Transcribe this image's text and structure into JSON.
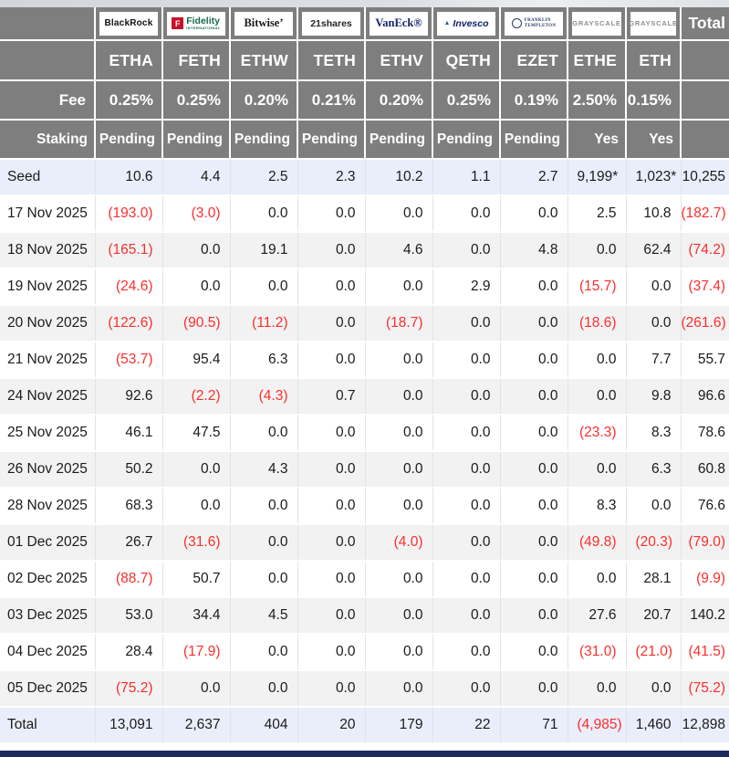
{
  "page": {
    "fee_label": "Fee",
    "staking_label": "Staking",
    "total_label": "Total",
    "colors": {
      "header_bg": "#7e7e7e",
      "negative_text": "#fb2d2d",
      "highlight_row_bg": "#e9eefa",
      "alt_row_bg": "#f2f2f2",
      "bottom_bar": "#1d2a5c"
    }
  },
  "chart_data": {
    "type": "table",
    "total_column_label": "Total",
    "row_header_labels": {
      "fee": "Fee",
      "staking": "Staking"
    },
    "columns": [
      {
        "issuer": "BlackRock",
        "ticker": "ETHA",
        "fee": "0.25%",
        "staking": "Pending",
        "logo": {
          "type": "blackrock",
          "text": "BlackRock"
        }
      },
      {
        "issuer": "Fidelity",
        "ticker": "FETH",
        "fee": "0.25%",
        "staking": "Pending",
        "logo": {
          "type": "fidelity",
          "icon": "F",
          "text": "Fidelity",
          "subtext": "INTERNATIONAL"
        }
      },
      {
        "issuer": "Bitwise",
        "ticker": "ETHW",
        "fee": "0.20%",
        "staking": "Pending",
        "logo": {
          "type": "bitwise",
          "text": "Bitwise’"
        }
      },
      {
        "issuer": "21shares",
        "ticker": "TETH",
        "fee": "0.21%",
        "staking": "Pending",
        "logo": {
          "type": "shares21",
          "text": "21shares"
        }
      },
      {
        "issuer": "VanEck",
        "ticker": "ETHV",
        "fee": "0.20%",
        "staking": "Pending",
        "logo": {
          "type": "vaneck",
          "text": "VanEck®"
        }
      },
      {
        "issuer": "Invesco",
        "ticker": "QETH",
        "fee": "0.25%",
        "staking": "Pending",
        "logo": {
          "type": "invesco",
          "icon": "▲",
          "text": "Invesco"
        }
      },
      {
        "issuer": "Franklin Templeton",
        "ticker": "EZET",
        "fee": "0.19%",
        "staking": "Pending",
        "logo": {
          "type": "franklin",
          "line1": "FRANKLIN",
          "line2": "TEMPLETON"
        }
      },
      {
        "issuer": "Grayscale",
        "ticker": "ETHE",
        "fee": "2.50%",
        "staking": "Yes",
        "logo": {
          "type": "grayscale",
          "text": "GRAYSCALE"
        }
      },
      {
        "issuer": "Grayscale",
        "ticker": "ETH",
        "fee": "0.15%",
        "staking": "Yes",
        "logo": {
          "type": "grayscale",
          "text": "GRAYSCALE"
        }
      }
    ],
    "rows": [
      {
        "label": "Seed",
        "values": [
          "10.6",
          "4.4",
          "2.5",
          "2.3",
          "10.2",
          "1.1",
          "2.7",
          "9,199*",
          "1,023*"
        ],
        "total": "10,255",
        "highlight": true
      },
      {
        "label": "17 Nov 2025",
        "values": [
          "(193.0)",
          "(3.0)",
          "0.0",
          "0.0",
          "0.0",
          "0.0",
          "0.0",
          "2.5",
          "10.8"
        ],
        "total": "(182.7)"
      },
      {
        "label": "18 Nov 2025",
        "values": [
          "(165.1)",
          "0.0",
          "19.1",
          "0.0",
          "4.6",
          "0.0",
          "4.8",
          "0.0",
          "62.4"
        ],
        "total": "(74.2)"
      },
      {
        "label": "19 Nov 2025",
        "values": [
          "(24.6)",
          "0.0",
          "0.0",
          "0.0",
          "0.0",
          "2.9",
          "0.0",
          "(15.7)",
          "0.0"
        ],
        "total": "(37.4)"
      },
      {
        "label": "20 Nov 2025",
        "values": [
          "(122.6)",
          "(90.5)",
          "(11.2)",
          "0.0",
          "(18.7)",
          "0.0",
          "0.0",
          "(18.6)",
          "0.0"
        ],
        "total": "(261.6)"
      },
      {
        "label": "21 Nov 2025",
        "values": [
          "(53.7)",
          "95.4",
          "6.3",
          "0.0",
          "0.0",
          "0.0",
          "0.0",
          "0.0",
          "7.7"
        ],
        "total": "55.7"
      },
      {
        "label": "24 Nov 2025",
        "values": [
          "92.6",
          "(2.2)",
          "(4.3)",
          "0.7",
          "0.0",
          "0.0",
          "0.0",
          "0.0",
          "9.8"
        ],
        "total": "96.6"
      },
      {
        "label": "25 Nov 2025",
        "values": [
          "46.1",
          "47.5",
          "0.0",
          "0.0",
          "0.0",
          "0.0",
          "0.0",
          "(23.3)",
          "8.3"
        ],
        "total": "78.6"
      },
      {
        "label": "26 Nov 2025",
        "values": [
          "50.2",
          "0.0",
          "4.3",
          "0.0",
          "0.0",
          "0.0",
          "0.0",
          "0.0",
          "6.3"
        ],
        "total": "60.8"
      },
      {
        "label": "28 Nov 2025",
        "values": [
          "68.3",
          "0.0",
          "0.0",
          "0.0",
          "0.0",
          "0.0",
          "0.0",
          "8.3",
          "0.0"
        ],
        "total": "76.6"
      },
      {
        "label": "01 Dec 2025",
        "values": [
          "26.7",
          "(31.6)",
          "0.0",
          "0.0",
          "(4.0)",
          "0.0",
          "0.0",
          "(49.8)",
          "(20.3)"
        ],
        "total": "(79.0)"
      },
      {
        "label": "02 Dec 2025",
        "values": [
          "(88.7)",
          "50.7",
          "0.0",
          "0.0",
          "0.0",
          "0.0",
          "0.0",
          "0.0",
          "28.1"
        ],
        "total": "(9.9)"
      },
      {
        "label": "03 Dec 2025",
        "values": [
          "53.0",
          "34.4",
          "4.5",
          "0.0",
          "0.0",
          "0.0",
          "0.0",
          "27.6",
          "20.7"
        ],
        "total": "140.2"
      },
      {
        "label": "04 Dec 2025",
        "values": [
          "28.4",
          "(17.9)",
          "0.0",
          "0.0",
          "0.0",
          "0.0",
          "0.0",
          "(31.0)",
          "(21.0)"
        ],
        "total": "(41.5)"
      },
      {
        "label": "05 Dec 2025",
        "values": [
          "(75.2)",
          "0.0",
          "0.0",
          "0.0",
          "0.0",
          "0.0",
          "0.0",
          "0.0",
          "0.0"
        ],
        "total": "(75.2)"
      },
      {
        "label": "Total",
        "values": [
          "13,091",
          "2,637",
          "404",
          "20",
          "179",
          "22",
          "71",
          "(4,985)",
          "1,460"
        ],
        "total": "12,898",
        "highlight": true
      }
    ]
  }
}
